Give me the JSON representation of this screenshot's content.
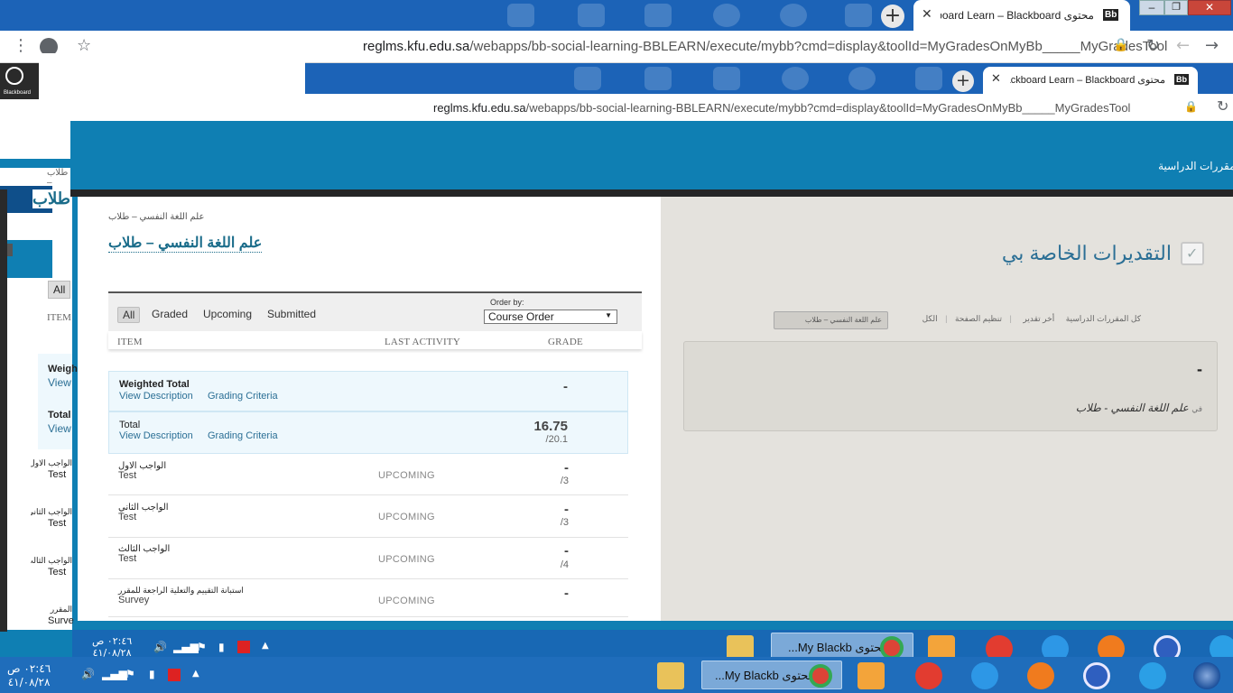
{
  "outer_browser": {
    "tab_title": "محتوى Blackboard Learn – Blackboard",
    "tab_badge": "Bb",
    "url": "reglms.kfu.edu.sa/webapps/bb-social-learning-BBLEARN/execute/mybb?cmd=display&toolId=MyGradesOnMyBb_____MyGradesTool",
    "url_domain": "reglms.kfu.edu.sa",
    "url_path": "/webapps/bb-social-learning-BBLEARN/execute/mybb?cmd=display&toolId=MyGradesOnMyBb_____MyGradesTool"
  },
  "inner_browser": {
    "tab_title": "محتوى Blackboard Learn – Blackboard",
    "tab_badge": "Bb",
    "url_domain": "reglms.kfu.edu.sa",
    "url_path": "/webapps/bb-social-learning-BBLEARN/execute/mybb?cmd=display&toolId=MyGradesOnMyBb_____MyGradesTool"
  },
  "header": {
    "nav_courses": "المقررات الدراسية"
  },
  "ghost_left": {
    "blackboard_label": "Blackboard",
    "all_label": "All",
    "item_label": "ITEM",
    "rows": [
      "Weigh",
      "View",
      "Total",
      "View",
      "الواجب الاول",
      "Test",
      "الواجب الثاني",
      "Test",
      "الواجب الثالث",
      "Test",
      "المقرر",
      "Surve"
    ],
    "title_fragment": "طلاب",
    "breadcrumb_fragment": "طلاب –"
  },
  "my_grades": {
    "title": "التقديرات الخاصة بي",
    "filters": [
      "كل المقررات الدراسية",
      "أخر تقدير",
      "تنظيم الصفحة",
      "الكل"
    ],
    "active_course": "علم اللغة النفسي – طلاب",
    "summary_grade": "-",
    "summary_course_prefix": "في",
    "summary_course": "علم اللغة النفسي - طلاب"
  },
  "course_panel": {
    "breadcrumb": "علم اللغة النفسي – طلاب",
    "title": "علم اللغة النفسي – طلاب",
    "filters": {
      "all": "All",
      "graded": "Graded",
      "upcoming": "Upcoming",
      "submitted": "Submitted"
    },
    "order_by_label": "Order by:",
    "order_by_value": "Course Order",
    "columns": {
      "item": "ITEM",
      "last_activity": "LAST ACTIVITY",
      "grade": "GRADE"
    },
    "view_description": "View Description",
    "grading_criteria": "Grading Criteria",
    "rows": [
      {
        "title": "Weighted Total",
        "sub": "",
        "status": "",
        "grade": "-",
        "possible": ""
      },
      {
        "title": "Total",
        "sub": "",
        "status": "",
        "grade": "16.75",
        "possible": "/20.1"
      },
      {
        "title": "الواجب الاول",
        "sub": "Test",
        "status": "UPCOMING",
        "grade": "-",
        "possible": "/3"
      },
      {
        "title": "الواجب الثاني",
        "sub": "Test",
        "status": "UPCOMING",
        "grade": "-",
        "possible": "/3"
      },
      {
        "title": "الواجب الثالث",
        "sub": "Test",
        "status": "UPCOMING",
        "grade": "-",
        "possible": "/4"
      },
      {
        "title": "استبانة التقييم والتعلية الراجعة للمقرر",
        "sub": "Survey",
        "status": "UPCOMING",
        "grade": "-",
        "possible": ""
      }
    ]
  },
  "taskbar_inner": {
    "time": "٠٢:٤٦ ص",
    "date": "٤١/٠٨/٢٨",
    "task_label": "محتوى My Blackb..."
  },
  "taskbar_outer": {
    "time": "٠٢:٤٦ ص",
    "date": "٤١/٠٨/٢٨",
    "task_label": "محتوى My Blackb..."
  },
  "colors": {
    "page_blue": "#0f7fb3",
    "chrome_blue": "#1c63b7",
    "link_teal": "#1a6c8a",
    "panel_gray": "#e4e2dd"
  }
}
